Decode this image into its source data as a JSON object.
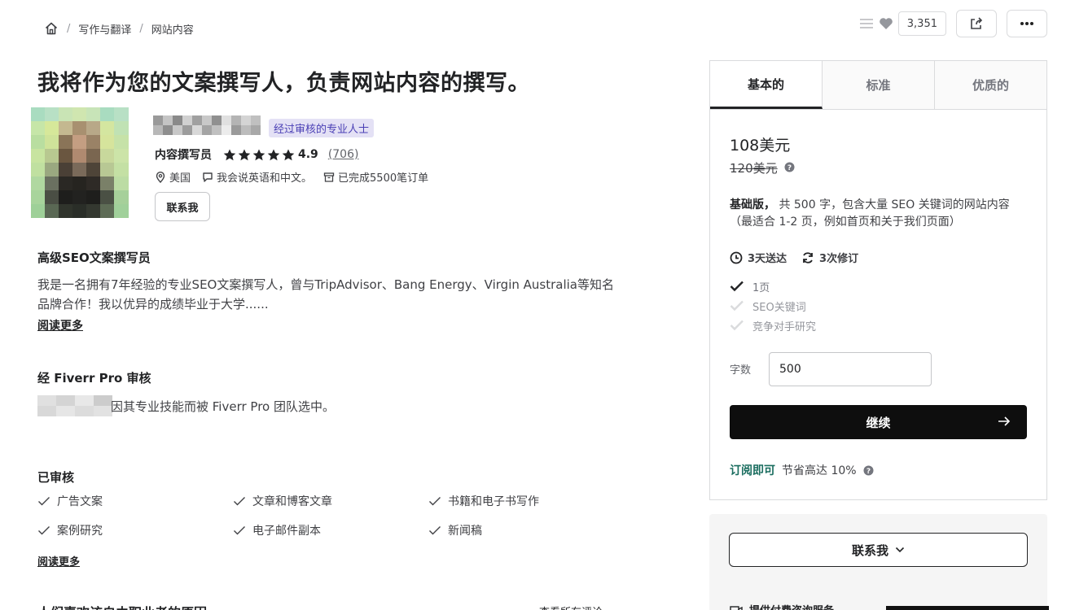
{
  "breadcrumb": {
    "items": [
      "写作与翻译",
      "网站内容"
    ],
    "separator": "/"
  },
  "header": {
    "save_count": "3,351"
  },
  "gig": {
    "title": "我将作为您的文案撰写人，负责网站内容的撰写。"
  },
  "seller": {
    "pro_badge": "经过审核的专业人士",
    "level": "内容撰写员",
    "rating": "4.9",
    "reviews": "(706)",
    "country": "美国",
    "languages": "我会说英语和中文。",
    "orders": "已完成5500笔订单",
    "contact_label": "联系我"
  },
  "about": {
    "heading": "高级SEO文案撰写员",
    "text": "我是一名拥有7年经验的专业SEO文案撰写人，曾与TripAdvisor、Bang Energy、Virgin Australia等知名品牌合作！我以优异的成绩毕业于大学......",
    "read_more": "阅读更多"
  },
  "pro": {
    "heading": "经 Fiverr Pro 审核",
    "text": "因其专业技能而被 Fiverr Pro 团队选中。"
  },
  "verified": {
    "heading": "已审核",
    "items": [
      "广告文案",
      "文章和博客文章",
      "书籍和电子书写作",
      "案例研究",
      "电子邮件副本",
      "新闻稿"
    ],
    "read_more": "阅读更多"
  },
  "below_fold": {
    "heading": "人们喜欢该自由职业者的原因",
    "link": "查看所有评论"
  },
  "package": {
    "tabs": [
      "基本的",
      "标准",
      "优质的"
    ],
    "price": "108美元",
    "old_price": "120美元",
    "desc_bold": "基础版，",
    "desc": "共 500 字，包含大量 SEO 关键词的网站内容（最适合 1-2 页，例如首页和关于我们页面）",
    "delivery": "3天送达",
    "revisions": "3次修订",
    "features": [
      {
        "label": "1页",
        "included": true
      },
      {
        "label": "SEO关键词",
        "included": false
      },
      {
        "label": "竞争对手研究",
        "included": false
      }
    ],
    "words_label": "字数",
    "words_value": "500",
    "continue_label": "继续",
    "subscribe_highlight": "订阅即可",
    "subscribe_text": "节省高达 10%"
  },
  "contact_panel": {
    "button_label": "联系我",
    "consult_label": "提供付费咨询服务"
  },
  "colors": {
    "accent_green": "#1a6d5f",
    "pro_badge_bg": "#e4e1f5",
    "pro_badge_text": "#4a3fb5"
  }
}
